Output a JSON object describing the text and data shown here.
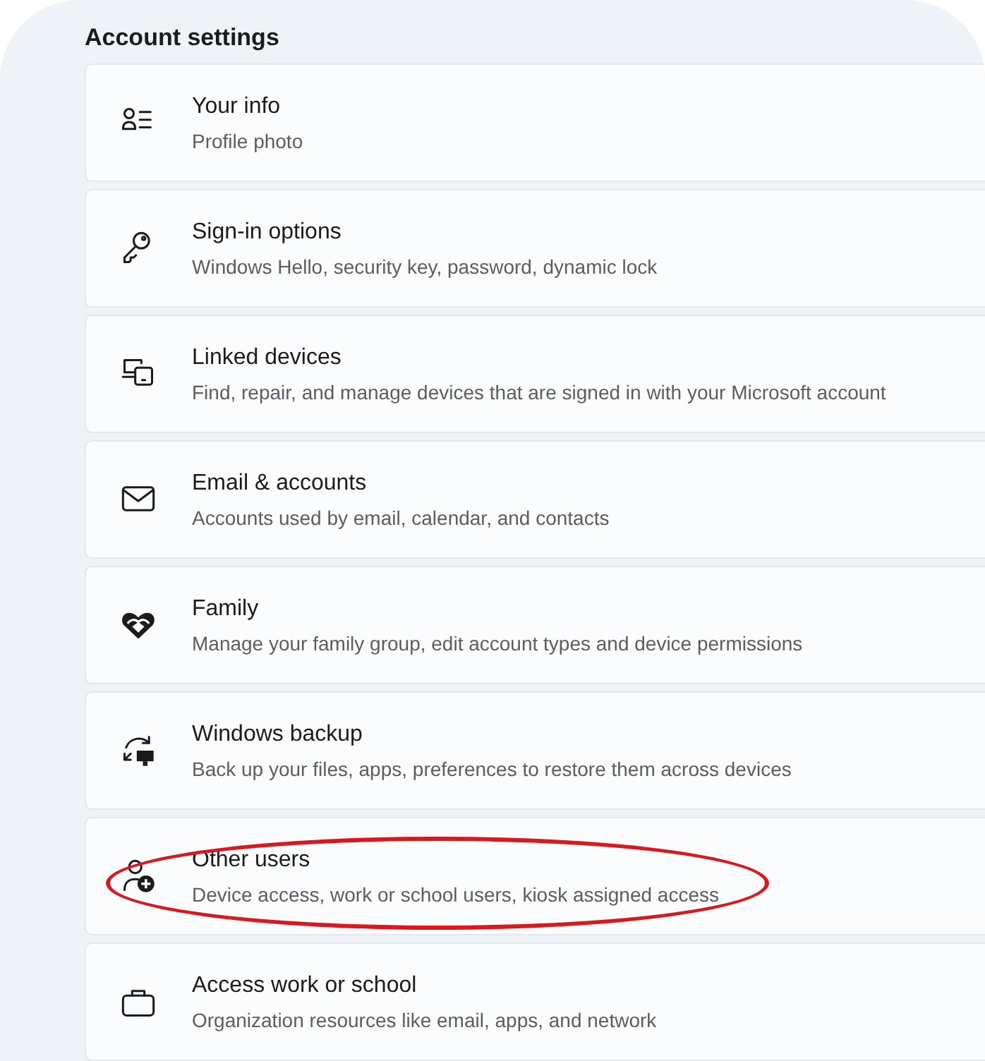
{
  "section_title": "Account settings",
  "items": [
    {
      "title": "Your info",
      "subtitle": "Profile photo",
      "highlighted": false
    },
    {
      "title": "Sign-in options",
      "subtitle": "Windows Hello, security key, password, dynamic lock",
      "highlighted": false
    },
    {
      "title": "Linked devices",
      "subtitle": "Find, repair, and manage devices that are signed in with your Microsoft account",
      "highlighted": false
    },
    {
      "title": "Email & accounts",
      "subtitle": "Accounts used by email, calendar, and contacts",
      "highlighted": false
    },
    {
      "title": "Family",
      "subtitle": "Manage your family group, edit account types and device permissions",
      "highlighted": false
    },
    {
      "title": "Windows backup",
      "subtitle": "Back up your files, apps, preferences to restore them across devices",
      "highlighted": false
    },
    {
      "title": "Other users",
      "subtitle": "Device access, work or school users, kiosk assigned access",
      "highlighted": true
    },
    {
      "title": "Access work or school",
      "subtitle": "Organization resources like email, apps, and network",
      "highlighted": false
    }
  ]
}
